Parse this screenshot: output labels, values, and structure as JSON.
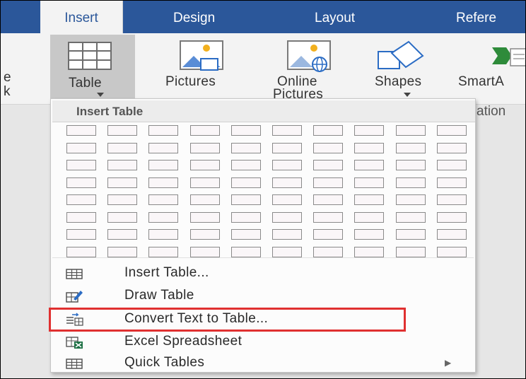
{
  "tabs": {
    "insert": "Insert",
    "design": "Design",
    "layout": "Layout",
    "references": "Refere"
  },
  "ribbon": {
    "left_partial_1": "e",
    "left_partial_2": "k",
    "table_label": "Table",
    "pictures_label": "Pictures",
    "online_label_1": "Online",
    "online_label_2": "Pictures",
    "shapes_label": "Shapes",
    "smartart_label": "SmartA",
    "illustrations_partial": "ation"
  },
  "menu": {
    "header": "Insert Table",
    "grid_cols": 10,
    "grid_rows": 8,
    "items": [
      {
        "label": "Insert Table...",
        "icon": "table-grid-icon"
      },
      {
        "label": "Draw Table",
        "icon": "draw-table-icon"
      },
      {
        "label": "Convert Text to Table...",
        "icon": "convert-text-icon"
      },
      {
        "label": "Excel Spreadsheet",
        "icon": "excel-spreadsheet-icon"
      },
      {
        "label": "Quick Tables",
        "icon": "quick-tables-icon",
        "submenu": true
      }
    ]
  },
  "colors": {
    "ribbon_tab_bg": "#2b579a",
    "highlight": "#e03030"
  }
}
